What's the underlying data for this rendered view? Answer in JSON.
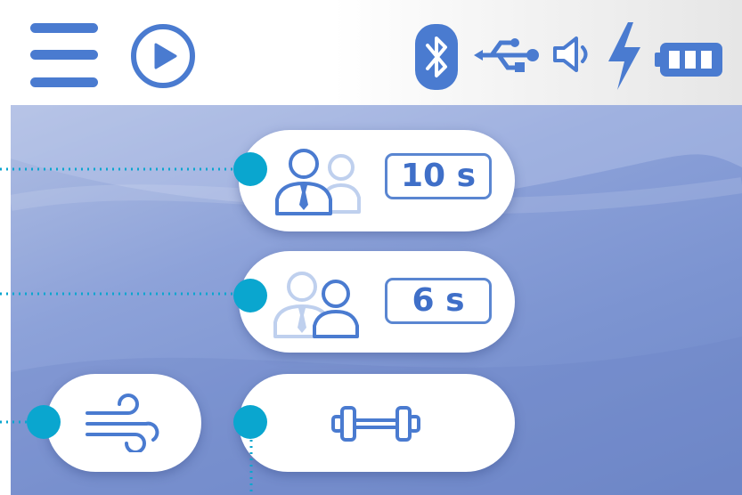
{
  "header": {
    "icons": [
      "menu-icon",
      "play-icon",
      "bluetooth-icon",
      "usb-icon",
      "speaker-icon",
      "charging-icon",
      "battery-icon"
    ]
  },
  "modes": [
    {
      "name": "presenter",
      "icon": "presenter-person-icon",
      "time_label": "10 s"
    },
    {
      "name": "listener",
      "icon": "listener-person-icon",
      "time_label": "6 s"
    }
  ],
  "bottom_buttons": [
    {
      "name": "breeze",
      "icon": "wind-icon"
    },
    {
      "name": "workout",
      "icon": "dumbbell-icon"
    }
  ],
  "colors": {
    "icon_blue": "#4a7bd0",
    "callout_teal": "#0aa6cf",
    "panel_blue": "#7c94d1"
  }
}
